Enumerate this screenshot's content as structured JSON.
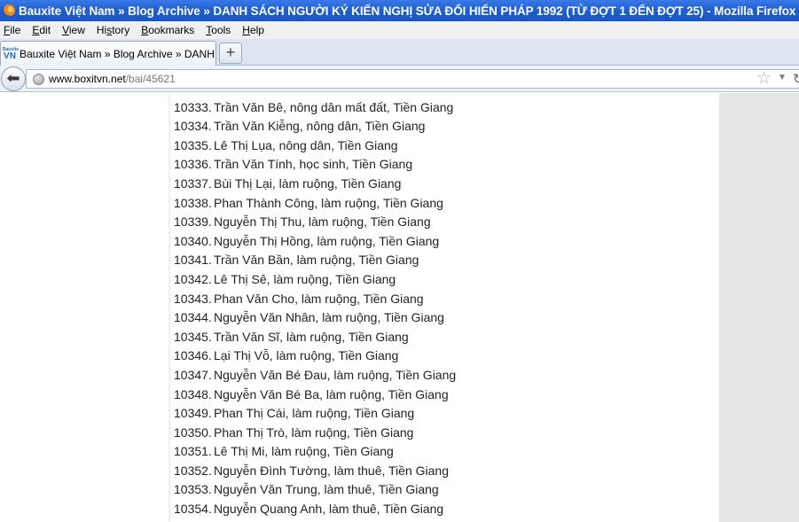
{
  "window": {
    "title": "Bauxite Việt Nam » Blog Archive » DANH SÁCH NGƯỜI KÝ KIẾN NGHỊ SỬA ĐỔI HIẾN PHÁP 1992 (TỪ ĐỢT 1 ĐẾN ĐỢT 25) - Mozilla Firefox"
  },
  "menu": [
    "File",
    "Edit",
    "View",
    "History",
    "Bookmarks",
    "Tools",
    "Help"
  ],
  "menu_accel": [
    "F",
    "E",
    "V",
    "s",
    "B",
    "T",
    "H"
  ],
  "tab": {
    "favicon_top": "Bauxite",
    "favicon_bottom": "VN",
    "label": "Bauxite Việt Nam » Blog Archive » DANH SÁ..."
  },
  "newtab_label": "+",
  "url": {
    "host": "www.boxitvn.net",
    "path": "/bai/45621"
  },
  "list": [
    {
      "num": "10333.",
      "text": "Trần Văn Bê, nông dân mất đất, Tiền Giang"
    },
    {
      "num": "10334.",
      "text": "Trần Văn Kiễng, nông dân, Tiền Giang"
    },
    {
      "num": "10335.",
      "text": "Lê Thị Lụa, nông dân, Tiền Giang"
    },
    {
      "num": "10336.",
      "text": "Trần Văn Tính, học sinh, Tiền Giang"
    },
    {
      "num": "10337.",
      "text": "Bùi Thị Lại, làm ruộng, Tiền Giang"
    },
    {
      "num": "10338.",
      "text": "Phan Thành Công, làm ruộng, Tiền Giang"
    },
    {
      "num": "10339.",
      "text": "Nguyễn Thị Thu, làm ruộng, Tiền Giang"
    },
    {
      "num": "10340.",
      "text": "Nguyễn Thị Hồng, làm ruộng, Tiền Giang"
    },
    {
      "num": "10341.",
      "text": "Trần Văn Bần, làm ruộng, Tiền Giang"
    },
    {
      "num": "10342.",
      "text": "Lê Thị Sê, làm ruộng, Tiền Giang"
    },
    {
      "num": "10343.",
      "text": "Phan Văn Cho, làm ruộng, Tiền Giang"
    },
    {
      "num": "10344.",
      "text": "Nguyễn Văn Nhân, làm ruộng, Tiền Giang"
    },
    {
      "num": "10345.",
      "text": "Trần Văn Sĩ, làm ruộng, Tiền Giang"
    },
    {
      "num": "10346.",
      "text": "Lại Thị Vỗ, làm ruộng, Tiền Giang"
    },
    {
      "num": "10347.",
      "text": "Nguyễn Văn Bé Đau, làm ruộng, Tiền Giang"
    },
    {
      "num": "10348.",
      "text": "Nguyễn Văn Bé Ba, làm ruộng, Tiền Giang"
    },
    {
      "num": "10349.",
      "text": "Phan Thị Cái, làm ruộng, Tiền Giang"
    },
    {
      "num": "10350.",
      "text": "Phan Thị Trò, làm ruộng, Tiền Giang"
    },
    {
      "num": "10351.",
      "text": "Lê Thị Mi, làm ruộng, Tiền Giang"
    },
    {
      "num": "10352.",
      "text": "Nguyễn Đình Tường, làm thuê, Tiền Giang"
    },
    {
      "num": "10353.",
      "text": "Nguyễn Văn Trung, làm thuê, Tiền Giang"
    },
    {
      "num": "10354.",
      "text": "Nguyễn Quang Anh, làm thuê, Tiền Giang"
    }
  ]
}
